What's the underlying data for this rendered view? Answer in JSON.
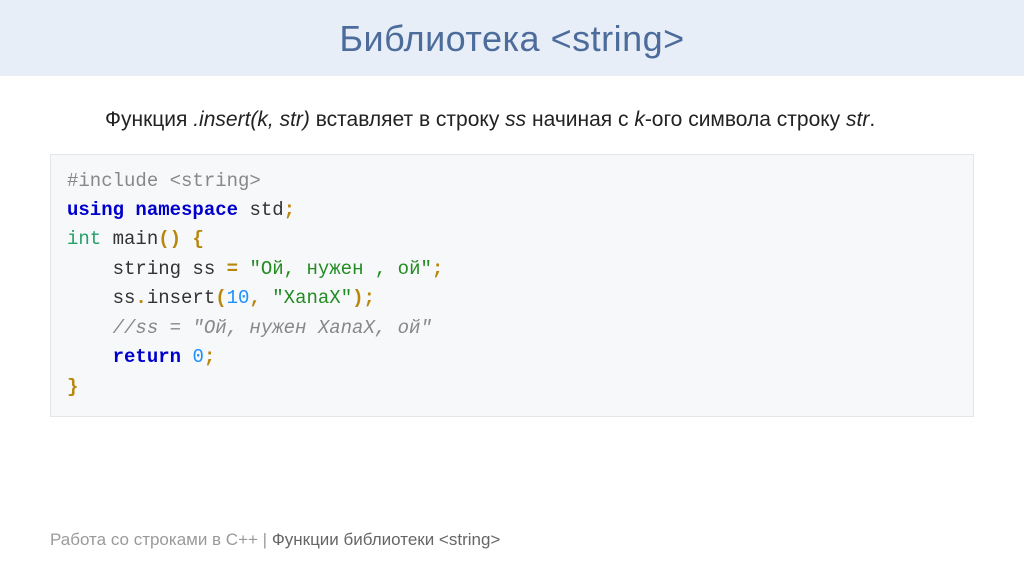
{
  "title": "Библиотека <string>",
  "description": {
    "prefix": "Функция ",
    "func": ".insert(k, str)",
    "mid1": " вставляет в строку ",
    "var_ss": "ss",
    "mid2": " начиная с ",
    "var_k": "k",
    "suffix_k": "-ого символа строку ",
    "var_str": "str",
    "period": "."
  },
  "code": {
    "l1": "#include <string>",
    "l2a": "using",
    "l2b": " ",
    "l2c": "namespace",
    "l2d": " std",
    "l2e": ";",
    "l3a": "int",
    "l3b": " ",
    "l3c": "main",
    "l3d": "()",
    "l3e": " ",
    "l3f": "{",
    "l4a": "    string ss ",
    "l4b": "=",
    "l4c": " ",
    "l4d": "\"Ой, нужен , ой\"",
    "l4e": ";",
    "l5a": "    ss",
    "l5b": ".",
    "l5c": "insert",
    "l5d": "(",
    "l5e": "10",
    "l5f": ",",
    "l5g": " ",
    "l5h": "\"XanaX\"",
    "l5i": ")",
    "l5j": ";",
    "l6": "    //ss = \"Ой, нужен XanaX, ой\"",
    "l7a": "    ",
    "l7b": "return",
    "l7c": " ",
    "l7d": "0",
    "l7e": ";",
    "l8": "}"
  },
  "footer": {
    "grey": "Работа со строками в C++ | ",
    "dark": "Функции библиотеки <string>"
  }
}
